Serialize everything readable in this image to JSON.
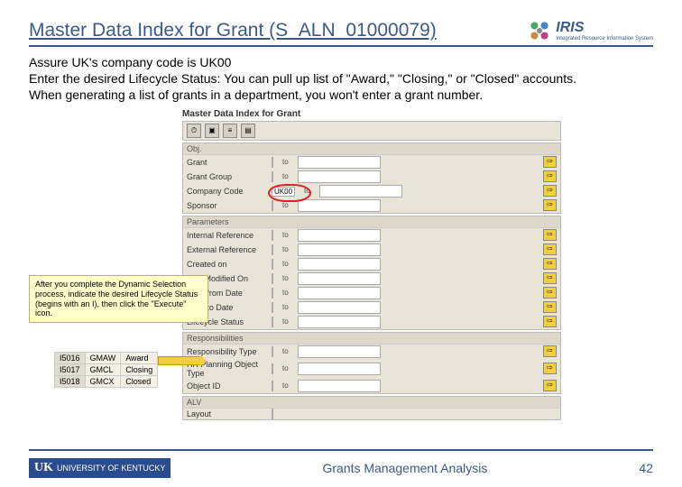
{
  "header": {
    "title": "Master Data Index for Grant (S_ALN_01000079)",
    "logo_text": "IRIS",
    "logo_sub": "Integrated Resource Information System"
  },
  "instructions": {
    "line1": "Assure UK's company code is UK00",
    "line2": "Enter the desired Lifecycle Status: You can pull up list of \"Award,\" \"Closing,\" or \"Closed\" accounts.",
    "line3": "When generating a list of grants in a department, you won't enter a grant number."
  },
  "sap": {
    "window_title": "Master Data Index for Grant",
    "toolbar_icons": [
      "clock-icon",
      "expand-icon",
      "funnel-icon",
      "variant-icon"
    ],
    "groups": [
      {
        "header": "Obj.",
        "rows": [
          {
            "label": "Grant",
            "to": "to"
          },
          {
            "label": "Grant Group",
            "to": "to"
          },
          {
            "label": "Company Code",
            "value": "UK00",
            "to": "to",
            "highlight": true
          },
          {
            "label": "Sponsor",
            "to": "to"
          }
        ]
      },
      {
        "header": "Parameters",
        "rows": [
          {
            "label": "Internal Reference",
            "to": "to"
          },
          {
            "label": "External Reference",
            "to": "to"
          },
          {
            "label": "Created on",
            "to": "to"
          },
          {
            "label": "Last Modified On",
            "to": "to"
          },
          {
            "label": "Valid-from Date",
            "to": "to"
          },
          {
            "label": "Valid-to Date",
            "to": "to"
          },
          {
            "label": "Lifecycle Status",
            "to": "to"
          }
        ]
      },
      {
        "header": "Responsibilities",
        "rows": [
          {
            "label": "Responsibility Type",
            "to": "to"
          },
          {
            "label": "HR Planning Object Type",
            "to": "to"
          },
          {
            "label": "Object ID",
            "to": "to"
          }
        ]
      },
      {
        "header": "ALV",
        "rows": [
          {
            "label": "Layout"
          }
        ]
      }
    ]
  },
  "callout": {
    "text": "After you complete the Dynamic Selection process, indicate the desired Lifecycle Status (begins with an I), then click the \"Execute\" icon."
  },
  "lifecycle": {
    "rows": [
      {
        "code": "I5016",
        "abbr": "GMAW",
        "name": "Award"
      },
      {
        "code": "I5017",
        "abbr": "GMCL",
        "name": "Closing"
      },
      {
        "code": "I5018",
        "abbr": "GMCX",
        "name": "Closed"
      }
    ]
  },
  "footer": {
    "uk_label": "UNIVERSITY OF KENTUCKY",
    "uk_short": "UK",
    "center": "Grants Management Analysis",
    "page": "42"
  }
}
